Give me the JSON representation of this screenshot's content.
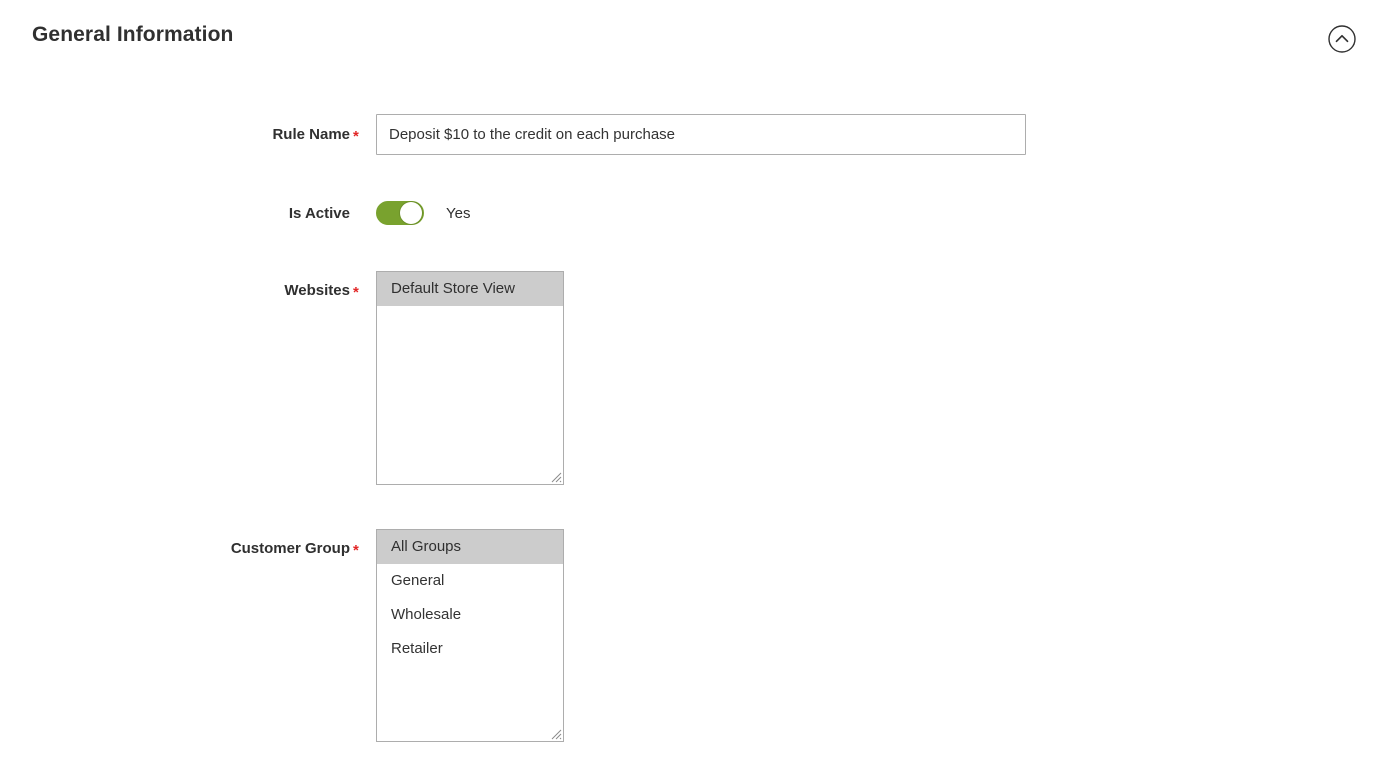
{
  "section": {
    "title": "General Information",
    "collapse_icon": "chevron-up-circle-icon",
    "collapsed": false
  },
  "colors": {
    "heading": "#303030",
    "label": "#303030",
    "required_asterisk": "#e22626",
    "input_border": "#adadad",
    "toggle_on": "#79a22e",
    "option_selected_bg": "#cccccc",
    "page_background": "#ffffff"
  },
  "fields": {
    "rule_name": {
      "label": "Rule Name",
      "required": true,
      "required_marker": "*",
      "value": "Deposit $10 to the credit on each purchase",
      "placeholder": ""
    },
    "is_active": {
      "label": "Is Active",
      "required": false,
      "state_label": "Yes",
      "checked": true
    },
    "websites": {
      "label": "Websites",
      "required": true,
      "required_marker": "*",
      "options": [
        {
          "label": "Default Store View",
          "selected": true
        }
      ]
    },
    "customer_group": {
      "label": "Customer Group",
      "required": true,
      "required_marker": "*",
      "options": [
        {
          "label": "All Groups",
          "selected": true
        },
        {
          "label": "General",
          "selected": false
        },
        {
          "label": "Wholesale",
          "selected": false
        },
        {
          "label": "Retailer",
          "selected": false
        }
      ]
    }
  }
}
